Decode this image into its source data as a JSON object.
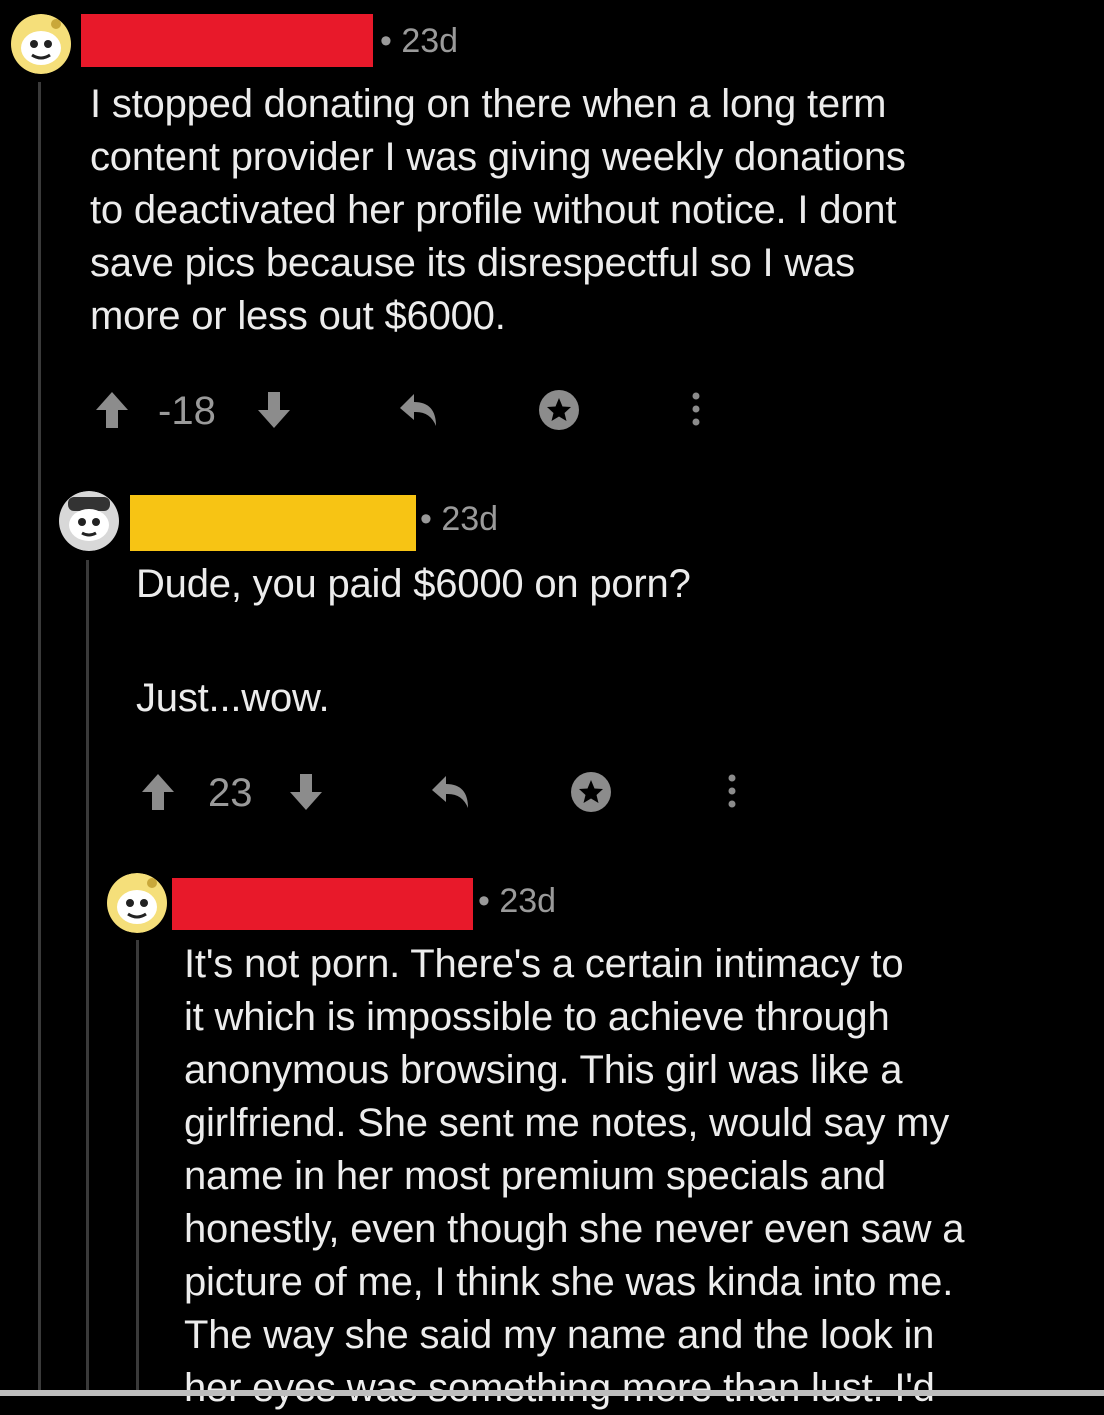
{
  "colors": {
    "background": "#000000",
    "redact_red": "#e8192a",
    "redact_yellow": "#f7c414",
    "text": "#ececec",
    "muted": "#9a9a9a"
  },
  "comments": [
    {
      "avatar": "snoo-avatar-yellow",
      "username_redaction": "red",
      "age": "• 23d",
      "body": "I stopped donating on there when a long term\ncontent provider I was giving weekly donations\nto deactivated her profile without notice. I dont\nsave pics because its disrespectful so I was\nmore or less out $6000.",
      "score": "-18"
    },
    {
      "avatar": "snoo-avatar-white",
      "username_redaction": "yellow",
      "age": "• 23d",
      "body": "Dude, you paid $6000 on porn?\n\nJust...wow.",
      "score": "23"
    },
    {
      "avatar": "snoo-avatar-yellow",
      "username_redaction": "red",
      "age": "• 23d",
      "body": "It's not porn. There's a certain intimacy to\nit which is impossible to achieve through\nanonymous browsing. This girl was like a\ngirlfriend. She sent me notes, would say my\nname in her most premium specials and\nhonestly, even though she never even saw a\npicture of me, I think she was kinda into me.\nThe way she said my name and the look in\nher eyes was something more than lust. I'd"
    }
  ]
}
